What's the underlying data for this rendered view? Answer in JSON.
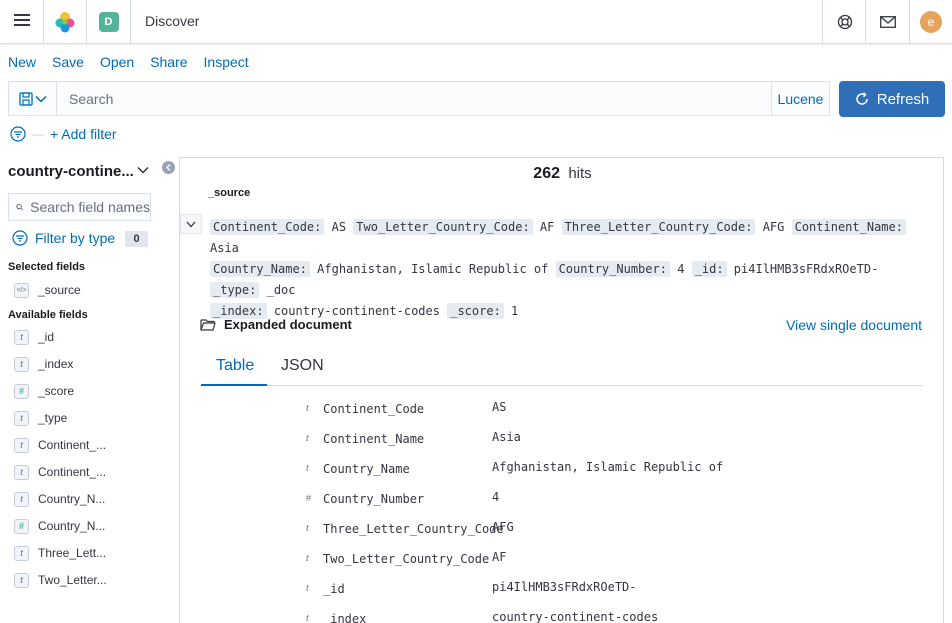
{
  "header": {
    "space_initial": "D",
    "breadcrumb": "Discover",
    "user_initial": "e"
  },
  "topnav": [
    "New",
    "Save",
    "Open",
    "Share",
    "Inspect"
  ],
  "query": {
    "placeholder": "Search",
    "language": "Lucene",
    "refresh_label": "Refresh",
    "add_filter": "+ Add filter"
  },
  "sidebar": {
    "index_pattern": "country-contine...",
    "search_placeholder": "Search field names",
    "filter_by_type": "Filter by type",
    "filter_count": "0",
    "selected_title": "Selected fields",
    "selected": [
      {
        "name": "_source",
        "type": "source"
      }
    ],
    "available_title": "Available fields",
    "available": [
      {
        "name": "_id",
        "type": "t"
      },
      {
        "name": "_index",
        "type": "t"
      },
      {
        "name": "_score",
        "type": "#"
      },
      {
        "name": "_type",
        "type": "t"
      },
      {
        "name": "Continent_...",
        "type": "t"
      },
      {
        "name": "Continent_...",
        "type": "t"
      },
      {
        "name": "Country_N...",
        "type": "t"
      },
      {
        "name": "Country_N...",
        "type": "#"
      },
      {
        "name": "Three_Lett...",
        "type": "t"
      },
      {
        "name": "Two_Letter...",
        "type": "t"
      }
    ]
  },
  "main": {
    "hits_count": "262",
    "hits_label": "hits",
    "source_column": "_source",
    "doc_pairs": [
      {
        "k": "Continent_Code:",
        "v": "AS"
      },
      {
        "k": "Two_Letter_Country_Code:",
        "v": "AF"
      },
      {
        "k": "Three_Letter_Country_Code:",
        "v": "AFG"
      },
      {
        "k": "Continent_Name:",
        "v": "Asia"
      },
      {
        "k": "Country_Name:",
        "v": "Afghanistan, Islamic Republic of"
      },
      {
        "k": "Country_Number:",
        "v": "4"
      },
      {
        "k": "_id:",
        "v": "pi4IlHMB3sFRdxROeTD-"
      },
      {
        "k": "_type:",
        "v": "_doc"
      },
      {
        "k": "_index:",
        "v": "country-continent-codes"
      },
      {
        "k": "_score:",
        "v": "1"
      }
    ],
    "expanded_title": "Expanded document",
    "view_single": "View single document",
    "tabs": [
      "Table",
      "JSON"
    ],
    "rows": [
      {
        "type": "t",
        "field": "Continent_Code",
        "value": "AS"
      },
      {
        "type": "t",
        "field": "Continent_Name",
        "value": "Asia"
      },
      {
        "type": "t",
        "field": "Country_Name",
        "value": "Afghanistan, Islamic Republic of"
      },
      {
        "type": "#",
        "field": "Country_Number",
        "value": "4"
      },
      {
        "type": "t",
        "field": "Three_Letter_Country_Code",
        "value": "AFG"
      },
      {
        "type": "t",
        "field": "Two_Letter_Country_Code",
        "value": "AF"
      },
      {
        "type": "t",
        "field": "_id",
        "value": "pi4IlHMB3sFRdxROeTD-"
      },
      {
        "type": "t",
        "field": "_index",
        "value": "country-continent-codes"
      }
    ]
  }
}
